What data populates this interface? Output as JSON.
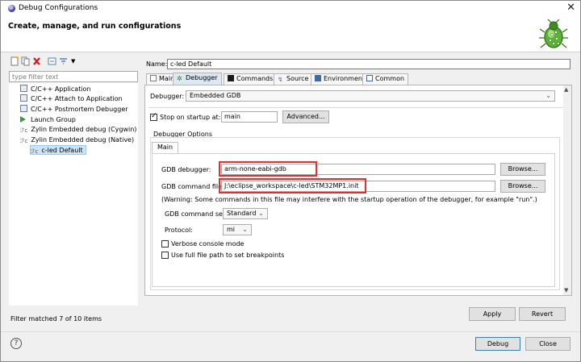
{
  "window": {
    "title": "Debug Configurations",
    "banner_title": "Create, manage, and run configurations"
  },
  "left": {
    "filter_placeholder": "type filter text",
    "tree": [
      {
        "label": "C/C++ Application",
        "icon": "c-app-icon"
      },
      {
        "label": "C/C++ Attach to Application",
        "icon": "c-attach-icon"
      },
      {
        "label": "C/C++ Postmortem Debugger",
        "icon": "c-postmortem-icon"
      },
      {
        "label": "Launch Group",
        "icon": "launch-group-icon"
      },
      {
        "label": "Zylin Embedded debug (Cygwin)",
        "icon": "zylin-icon"
      },
      {
        "label": "Zylin Embedded debug (Native)",
        "icon": "zylin-icon"
      },
      {
        "label": "c-led Default",
        "icon": "zylin-icon",
        "selected": true
      }
    ],
    "matched": "Filter matched 7 of 10 items"
  },
  "right": {
    "name_label": "Name:",
    "name_value": "c-led Default",
    "tabs": [
      "Main",
      "Debugger",
      "Commands",
      "Source",
      "Environment",
      "Common"
    ],
    "debugger_label": "Debugger:",
    "debugger_value": "Embedded GDB",
    "stop_on_startup_label": "Stop on startup at:",
    "stop_on_startup_checked": true,
    "stop_on_startup_value": "main",
    "advanced_label": "Advanced...",
    "options_title": "Debugger Options",
    "options_tab": "Main",
    "gdb_debugger_label": "GDB debugger:",
    "gdb_debugger_value": "arm-none-eabi-gdb",
    "gdb_command_file_label": "GDB command file:",
    "gdb_command_file_value": "J:\\eclipse_workspace\\c-led\\STM32MP1.init",
    "browse_label": "Browse...",
    "warning": "(Warning: Some commands in this file may interfere with the startup operation of the debugger, for example \"run\".)",
    "command_set_label": "GDB command set:",
    "command_set_value": "Standard",
    "protocol_label": "Protocol:",
    "protocol_value": "mi",
    "verbose_label": "Verbose console mode",
    "fullpath_label": "Use full file path to set breakpoints",
    "apply_label": "Apply",
    "revert_label": "Revert"
  },
  "bottom": {
    "help": "?",
    "debug_label": "Debug",
    "close_label": "Close"
  },
  "colors": {
    "highlight_box": "#e03030",
    "selection": "#cce4f7",
    "accent": "#3c7fb1"
  }
}
